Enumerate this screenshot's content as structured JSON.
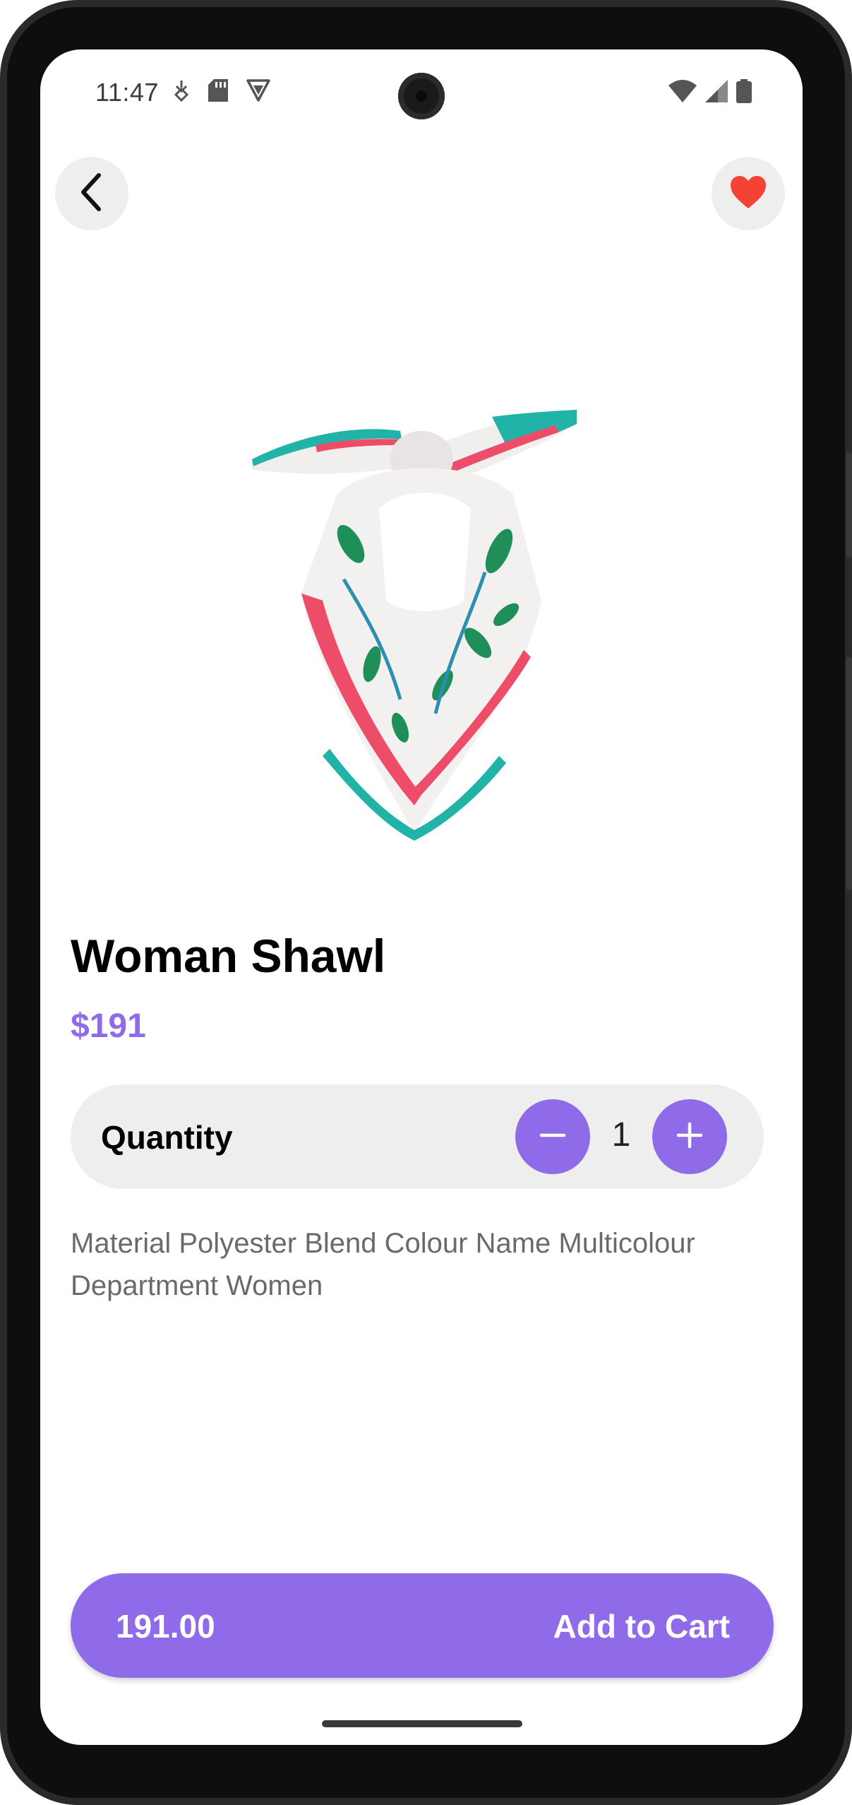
{
  "status_bar": {
    "time": "11:47",
    "left_icons": [
      "pulse-icon",
      "sd-card-icon",
      "vpn-shield-icon"
    ],
    "right_icons": [
      "wifi-icon",
      "cellular-signal-icon",
      "battery-icon"
    ]
  },
  "header": {
    "back_icon": "chevron-left-icon",
    "favorite_icon": "heart-icon",
    "favorite_color": "#f44336"
  },
  "product": {
    "title": "Woman Shawl",
    "price": "$191",
    "quantity_label": "Quantity",
    "quantity_value": "1",
    "description": "Material Polyester Blend Colour Name Multicolour Department Women",
    "image_alt": "printed shawl"
  },
  "cart": {
    "total": "191.00",
    "button_label": "Add to Cart"
  },
  "colors": {
    "accent": "#8f6ae9",
    "surface": "#eeeeee",
    "text_muted": "#6a6a6a"
  }
}
